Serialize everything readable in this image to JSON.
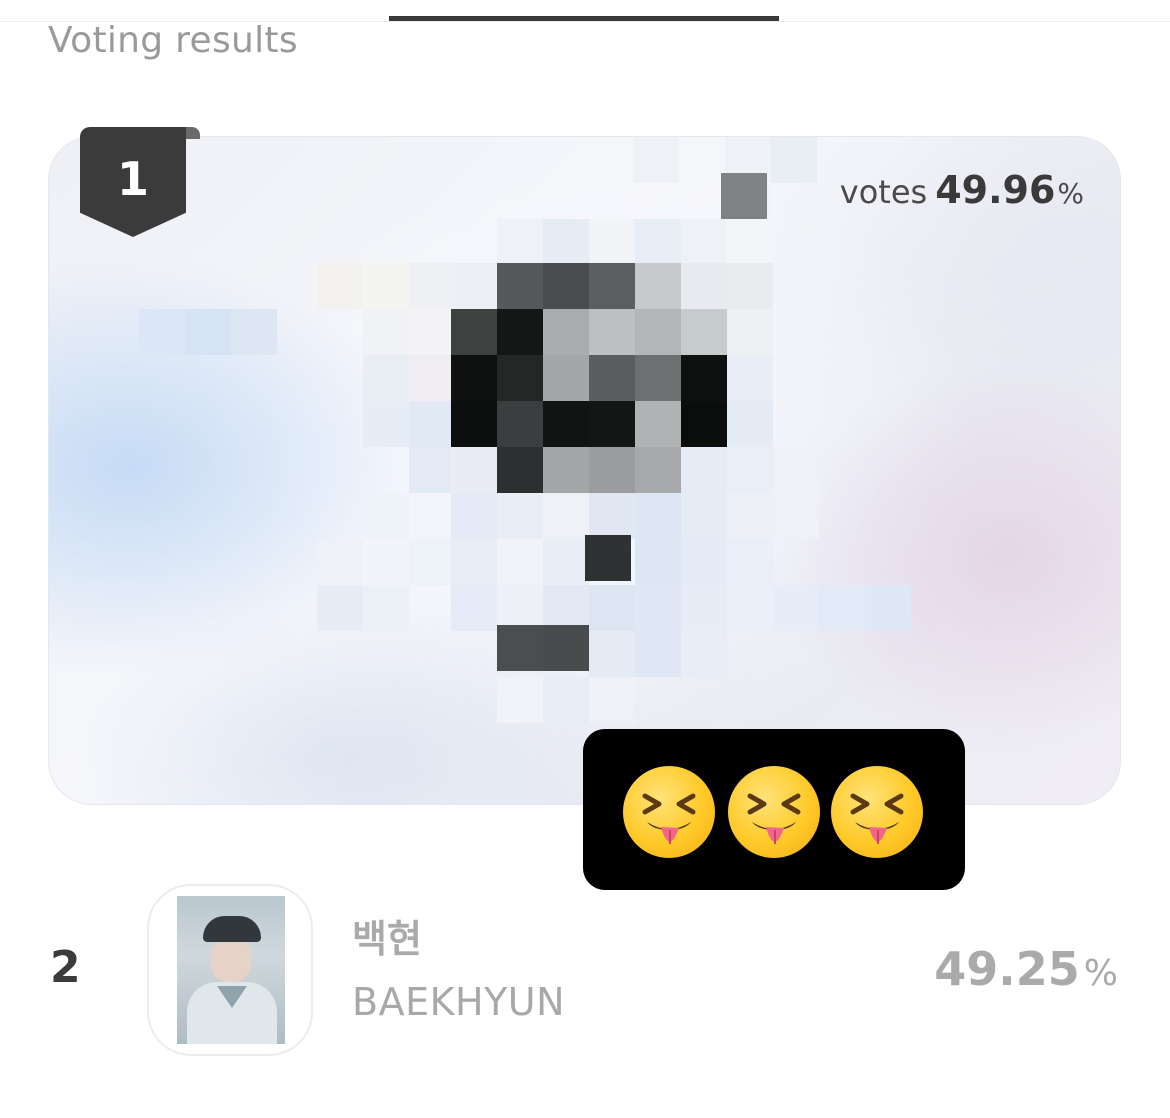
{
  "section": {
    "title": "Voting results"
  },
  "winner": {
    "rank": "1",
    "votes_label": "votes",
    "votes_value": "49.96",
    "votes_unit": "%",
    "emoji_icon": "squinting-face-with-tongue-icon"
  },
  "runner_up": {
    "rank": "2",
    "name_korean": "백현",
    "name_english": "BAEKHYUN",
    "percent_value": "49.25",
    "percent_unit": "%"
  },
  "colors": {
    "badge": "#3b3b3b",
    "muted_text": "#aaaaaa",
    "emoji_box": "#000000"
  }
}
